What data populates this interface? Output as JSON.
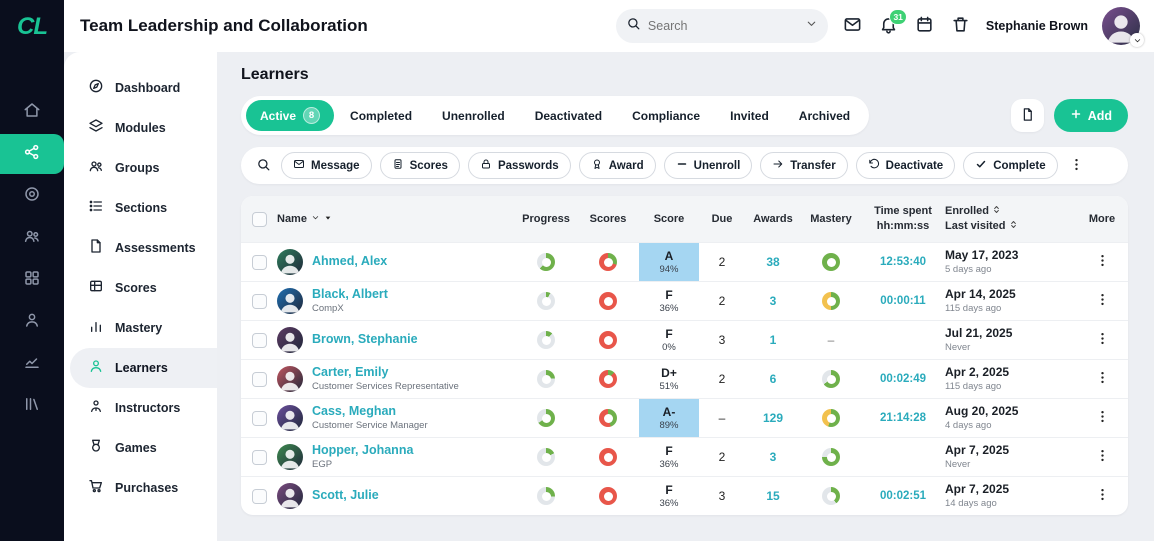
{
  "app": {
    "logo_text": "CL",
    "course_title": "Team Leadership and Collaboration"
  },
  "header": {
    "search_placeholder": "Search",
    "notification_count": "31",
    "user_name": "Stephanie Brown"
  },
  "rail": {
    "items": [
      {
        "icon": "home-icon",
        "active": false
      },
      {
        "icon": "network-icon",
        "active": true
      },
      {
        "icon": "target-icon",
        "active": false
      },
      {
        "icon": "groups-icon",
        "active": false
      },
      {
        "icon": "apps-icon",
        "active": false
      },
      {
        "icon": "person-icon",
        "active": false
      },
      {
        "icon": "chart-icon",
        "active": false
      },
      {
        "icon": "library-icon",
        "active": false
      }
    ]
  },
  "sidebar": {
    "items": [
      {
        "label": "Dashboard",
        "icon": "dashboard-icon",
        "active": false
      },
      {
        "label": "Modules",
        "icon": "modules-icon",
        "active": false
      },
      {
        "label": "Groups",
        "icon": "groups-icon",
        "active": false
      },
      {
        "label": "Sections",
        "icon": "sections-icon",
        "active": false
      },
      {
        "label": "Assessments",
        "icon": "assessments-icon",
        "active": false
      },
      {
        "label": "Scores",
        "icon": "scores-icon",
        "active": false
      },
      {
        "label": "Mastery",
        "icon": "mastery-icon",
        "active": false
      },
      {
        "label": "Learners",
        "icon": "learners-icon",
        "active": true
      },
      {
        "label": "Instructors",
        "icon": "instructors-icon",
        "active": false
      },
      {
        "label": "Games",
        "icon": "games-icon",
        "active": false
      },
      {
        "label": "Purchases",
        "icon": "purchases-icon",
        "active": false
      }
    ]
  },
  "main": {
    "title": "Learners",
    "tabs": [
      {
        "label": "Active",
        "count": "8",
        "active": true
      },
      {
        "label": "Completed",
        "active": false
      },
      {
        "label": "Unenrolled",
        "active": false
      },
      {
        "label": "Deactivated",
        "active": false
      },
      {
        "label": "Compliance",
        "active": false
      },
      {
        "label": "Invited",
        "active": false
      },
      {
        "label": "Archived",
        "active": false
      }
    ],
    "add_label": "Add",
    "toolbar": [
      {
        "label": "Message",
        "icon": "envelope-icon"
      },
      {
        "label": "Scores",
        "icon": "doc-icon"
      },
      {
        "label": "Passwords",
        "icon": "lock-icon"
      },
      {
        "label": "Award",
        "icon": "award-icon"
      },
      {
        "label": "Unenroll",
        "icon": "minus-icon"
      },
      {
        "label": "Transfer",
        "icon": "arrow-right-icon"
      },
      {
        "label": "Deactivate",
        "icon": "rotate-icon"
      },
      {
        "label": "Complete",
        "icon": "check-icon"
      }
    ]
  },
  "table": {
    "headers": {
      "name": "Name",
      "progress": "Progress",
      "scores": "Scores",
      "score": "Score",
      "due": "Due",
      "awards": "Awards",
      "mastery": "Mastery",
      "time_line1": "Time spent",
      "time_line2": "hh:mm:ss",
      "enrolled": "Enrolled",
      "last_visited": "Last visited",
      "more": "More"
    },
    "rows": [
      {
        "name": "Ahmed, Alex",
        "subtitle": "",
        "avatar_color": "#2e7d5b",
        "progress_pct": 62,
        "scores_segments": [
          {
            "color": "green",
            "pct": 30
          },
          {
            "color": "red",
            "pct": 70
          }
        ],
        "grade": "A",
        "score_pct": "94%",
        "score_highlighted": true,
        "due": "2",
        "awards": "38",
        "mastery_segments": [
          {
            "color": "green",
            "pct": 100
          }
        ],
        "time_spent": "12:53:40",
        "enrolled": "May 17, 2023",
        "last_visited": "5 days ago"
      },
      {
        "name": "Black, Albert",
        "subtitle": "CompX",
        "avatar_color": "#1f6fb2",
        "progress_pct": 8,
        "scores_segments": [
          {
            "color": "red",
            "pct": 100
          }
        ],
        "grade": "F",
        "score_pct": "36%",
        "score_highlighted": false,
        "due": "2",
        "awards": "3",
        "mastery_segments": [
          {
            "color": "green",
            "pct": 50
          },
          {
            "color": "yellow",
            "pct": 50
          }
        ],
        "time_spent": "00:00:11",
        "enrolled": "Apr 14, 2025",
        "last_visited": "115 days ago"
      },
      {
        "name": "Brown, Stephanie",
        "subtitle": "",
        "avatar_color": "#5c3a62",
        "progress_pct": 12,
        "scores_segments": [
          {
            "color": "red",
            "pct": 100
          }
        ],
        "grade": "F",
        "score_pct": "0%",
        "score_highlighted": false,
        "due": "3",
        "awards": "1",
        "mastery_segments": null,
        "time_spent": "",
        "enrolled": "Jul 21, 2025",
        "last_visited": "Never"
      },
      {
        "name": "Carter, Emily",
        "subtitle": "Customer Services Representative",
        "avatar_color": "#c2555f",
        "progress_pct": 24,
        "scores_segments": [
          {
            "color": "green",
            "pct": 12
          },
          {
            "color": "red",
            "pct": 88
          }
        ],
        "grade": "D+",
        "score_pct": "51%",
        "score_highlighted": false,
        "due": "2",
        "awards": "6",
        "mastery_segments": [
          {
            "color": "green",
            "pct": 65
          }
        ],
        "time_spent": "00:02:49",
        "enrolled": "Apr 2, 2025",
        "last_visited": "115 days ago"
      },
      {
        "name": "Cass, Meghan",
        "subtitle": "Customer Service Manager",
        "avatar_color": "#6a4e9c",
        "progress_pct": 66,
        "scores_segments": [
          {
            "color": "green",
            "pct": 45
          },
          {
            "color": "red",
            "pct": 55
          }
        ],
        "grade": "A-",
        "score_pct": "89%",
        "score_highlighted": true,
        "due": "–",
        "awards": "129",
        "mastery_segments": [
          {
            "color": "green",
            "pct": 55
          },
          {
            "color": "yellow",
            "pct": 45
          }
        ],
        "time_spent": "21:14:28",
        "enrolled": "Aug 20, 2025",
        "last_visited": "4 days ago"
      },
      {
        "name": "Hopper, Johanna",
        "subtitle": "EGP",
        "avatar_color": "#3d8a4f",
        "progress_pct": 18,
        "scores_segments": [
          {
            "color": "red",
            "pct": 100
          }
        ],
        "grade": "F",
        "score_pct": "36%",
        "score_highlighted": false,
        "due": "2",
        "awards": "3",
        "mastery_segments": [
          {
            "color": "green",
            "pct": 75
          }
        ],
        "time_spent": "",
        "enrolled": "Apr 7, 2025",
        "last_visited": "Never"
      },
      {
        "name": "Scott, Julie",
        "subtitle": "",
        "avatar_color": "#7b4a7f",
        "progress_pct": 26,
        "scores_segments": [
          {
            "color": "red",
            "pct": 100
          }
        ],
        "grade": "F",
        "score_pct": "36%",
        "score_highlighted": false,
        "due": "3",
        "awards": "15",
        "mastery_segments": [
          {
            "color": "green",
            "pct": 40
          }
        ],
        "time_spent": "00:02:51",
        "enrolled": "Apr 7, 2025",
        "last_visited": "14 days ago"
      }
    ]
  },
  "colors": {
    "accent": "#19c394",
    "link": "#2aabbc",
    "badge_green": "#3ed174",
    "score_highlight": "#a5d6f2",
    "donut_green": "#6fb14b",
    "donut_red": "#e8564a",
    "donut_yellow": "#f2c14e",
    "donut_gray": "#e2e6ea"
  }
}
